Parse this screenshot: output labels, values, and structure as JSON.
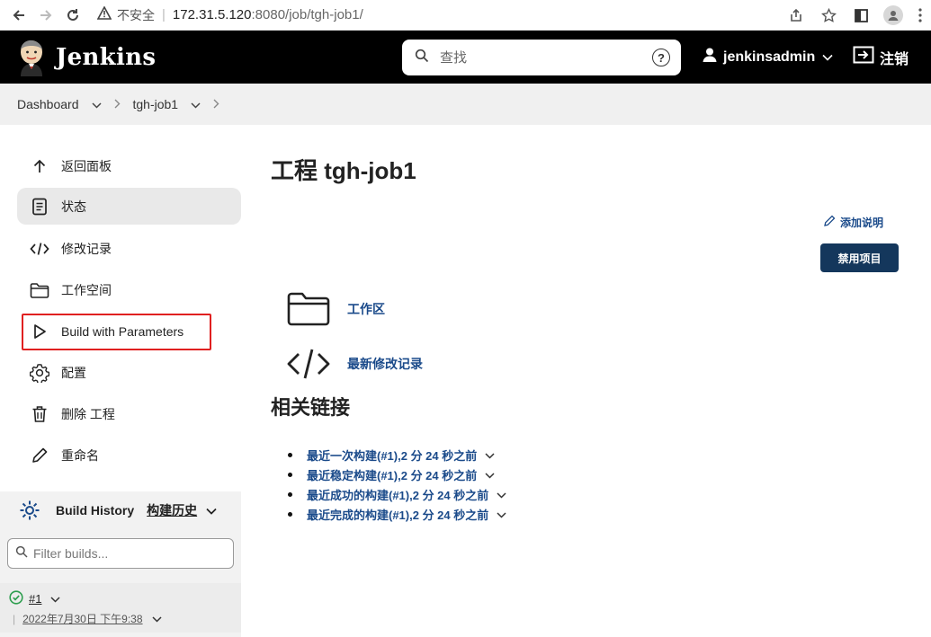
{
  "browser": {
    "insecure_label": "不安全",
    "url_host": "172.31.5.120",
    "url_rest": ":8080/job/tgh-job1/"
  },
  "header": {
    "brand": "Jenkins",
    "search_placeholder": "查找",
    "help_glyph": "?",
    "username": "jenkinsadmin",
    "logout_label": "注销"
  },
  "breadcrumb": {
    "dashboard": "Dashboard",
    "job": "tgh-job1"
  },
  "sidebar": {
    "tasks": [
      {
        "label": "返回面板",
        "icon": "arrow-up-icon"
      },
      {
        "label": "状态",
        "icon": "document-icon"
      },
      {
        "label": "修改记录",
        "icon": "code-icon"
      },
      {
        "label": "工作空间",
        "icon": "folder-icon"
      },
      {
        "label": "Build with Parameters",
        "icon": "play-icon"
      },
      {
        "label": "配置",
        "icon": "gear-icon"
      },
      {
        "label": "删除 工程",
        "icon": "trash-icon"
      },
      {
        "label": "重命名",
        "icon": "pencil-icon"
      }
    ],
    "active_task": "状态",
    "highlighted_task": "Build with Parameters"
  },
  "build_history": {
    "title": "Build History",
    "link": "构建历史",
    "filter_placeholder": "Filter builds...",
    "builds": [
      {
        "number": "#1",
        "date": "2022年7月30日 下午9:38",
        "status": "success"
      }
    ]
  },
  "main": {
    "title": "工程 tgh-job1",
    "add_description": "添加说明",
    "disable_button": "禁用项目",
    "links": [
      {
        "label": "工作区",
        "icon": "folder-icon"
      },
      {
        "label": "最新修改记录",
        "icon": "code-icon"
      }
    ],
    "permalinks_title": "相关链接",
    "permalinks": [
      "最近一次构建(#1),2 分 24 秒之前",
      "最近稳定构建(#1),2 分 24 秒之前",
      "最近成功的构建(#1),2 分 24 秒之前",
      "最近完成的构建(#1),2 分 24 秒之前"
    ]
  },
  "colors": {
    "header_bg": "#000000",
    "link": "#1a4a8a",
    "button_bg": "#14375c",
    "highlight_border": "#e02020",
    "success": "#2e9e4f"
  }
}
